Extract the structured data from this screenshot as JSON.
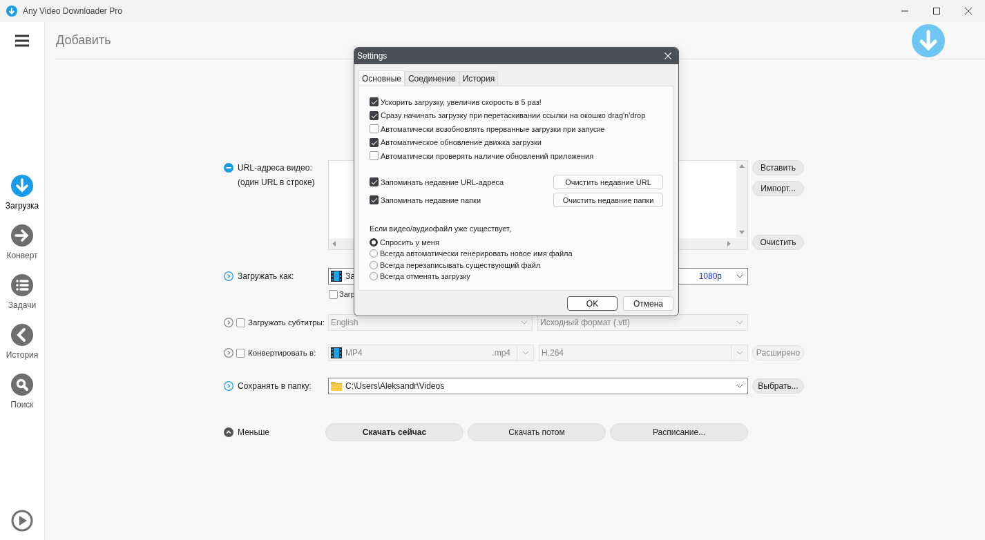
{
  "window": {
    "title": "Any Video Downloader Pro"
  },
  "sidebar": {
    "items": [
      {
        "label": "Загрузка",
        "kind": "download",
        "selected": true
      },
      {
        "label": "Конверт",
        "kind": "convert",
        "selected": false
      },
      {
        "label": "Задачи",
        "kind": "tasks",
        "selected": false
      },
      {
        "label": "История",
        "kind": "history",
        "selected": false
      },
      {
        "label": "Поиск",
        "kind": "search",
        "selected": false
      }
    ]
  },
  "page": {
    "title": "Добавить"
  },
  "form": {
    "url": {
      "label": "URL-адреса видео:",
      "hint": "(один URL в строке)",
      "buttons": [
        "Вставить",
        "Импорт...",
        "Очистить"
      ]
    },
    "download_as": {
      "label": "Загружать как:",
      "value": "За",
      "quality": "1080p",
      "option": {
        "label": "Загр",
        "checked": false
      }
    },
    "subtitles": {
      "label": "Загружать субтитры:",
      "checked": false,
      "language": "English",
      "format": "Исходный формат (.vtt)"
    },
    "convert": {
      "label": "Конвертировать в:",
      "checked": false,
      "format": "MP4",
      "extension": ".mp4",
      "codec": "H.264",
      "button": "Расширено"
    },
    "save_folder": {
      "label": "Сохранять в папку:",
      "path": "C:\\Users\\Aleksandr\\Videos",
      "button": "Выбрать..."
    },
    "less": {
      "label": "Меньше"
    },
    "actions": [
      {
        "label": "Скачать сейчас",
        "primary": true
      },
      {
        "label": "Скачать потом",
        "primary": false
      },
      {
        "label": "Расписание...",
        "primary": false
      }
    ]
  },
  "dialog": {
    "title": "Settings",
    "tabs": [
      {
        "label": "Основные",
        "selected": true
      },
      {
        "label": "Соединение",
        "selected": false
      },
      {
        "label": "История",
        "selected": false
      }
    ],
    "options": [
      {
        "label": "Ускорить загрузку, увеличив скорость в 5 раз!",
        "checked": true
      },
      {
        "label": "Сразу начинать загрузку при перетаскивании ссылки на окошко drag'n'drop",
        "checked": true
      },
      {
        "label": "Автоматически возобновлять прерванные загрузки при запуске",
        "checked": false
      },
      {
        "label": "Автоматическое обновление движка загрузки",
        "checked": true
      },
      {
        "label": "Автоматически проверять наличие обновлений приложения",
        "checked": false
      }
    ],
    "remember": [
      {
        "label": "Запоминать недавние URL-адреса",
        "checked": true,
        "button": "Очистить недавние URL"
      },
      {
        "label": "Запоминать недавние папки",
        "checked": true,
        "button": "Очистить недавние папки"
      }
    ],
    "exists_label": "Если видео/аудиофайл уже существует,",
    "radios": [
      {
        "label": "Спросить у меня",
        "selected": true
      },
      {
        "label": "Всегда автоматически генерировать новое имя файла",
        "selected": false
      },
      {
        "label": "Всегда перезаписывать существующий файл",
        "selected": false
      },
      {
        "label": "Всегда отменять загрузку",
        "selected": false
      }
    ],
    "buttons": [
      {
        "label": "OK",
        "default": true
      },
      {
        "label": "Отмена",
        "default": false
      }
    ]
  }
}
